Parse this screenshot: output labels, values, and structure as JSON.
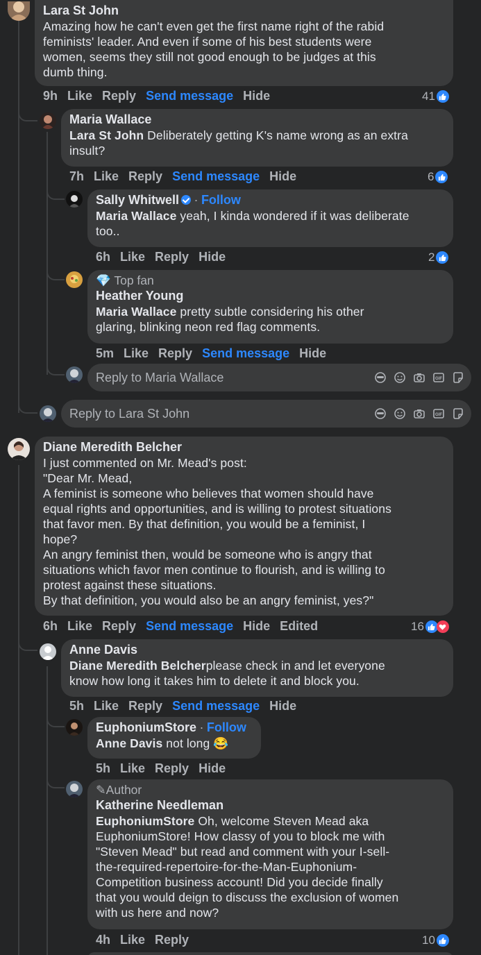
{
  "comments": [
    {
      "id": "lara",
      "author": "Lara St John",
      "lines": [
        "Amazing how he can't even get the first name right of the rabid",
        "feminists' leader. And even if some of his best students were",
        "women, seems they still not good enough to be judges at this",
        "dumb thing."
      ],
      "time": "9h",
      "actions": {
        "like": "Like",
        "reply": "Reply",
        "send": "Send message",
        "hide": "Hide"
      },
      "reactions": "41"
    },
    {
      "id": "maria",
      "author": "Maria Wallace",
      "mention": "Lara St John",
      "line1_rest": " Deliberately getting K's name wrong as an extra",
      "line2": "insult?",
      "time": "7h",
      "actions": {
        "like": "Like",
        "reply": "Reply",
        "send": "Send message",
        "hide": "Hide"
      },
      "reactions": "6"
    },
    {
      "id": "sally",
      "author": "Sally Whitwell",
      "separator": "·",
      "follow": "Follow",
      "mention": "Maria Wallace",
      "line1_rest": " yeah, I kinda wondered if it was deliberate",
      "line2": "too..",
      "time": "6h",
      "actions": {
        "like": "Like",
        "reply": "Reply",
        "hide": "Hide"
      },
      "reactions": "2"
    },
    {
      "id": "heather",
      "badge": "Top fan",
      "author": "Heather Young",
      "mention": "Maria Wallace",
      "line1_rest": " pretty subtle considering his other",
      "line2": "glaring, blinking neon red flag comments.",
      "time": "5m",
      "actions": {
        "like": "Like",
        "reply": "Reply",
        "send": "Send message",
        "hide": "Hide"
      }
    },
    {
      "id": "diane",
      "author": "Diane Meredith Belcher",
      "lines": [
        "I just commented on Mr. Mead's post:",
        "\"Dear Mr. Mead,",
        "A feminist is someone who believes that women should have",
        "equal rights and opportunities, and is willing to protest situations",
        "that favor men. By that definition, you would be a feminist, I",
        "hope?",
        "An angry feminist then, would be someone who is angry that",
        "situations which favor men continue to flourish, and is willing to",
        "protest against these situations.",
        "By that definition, you would also be an angry feminist, yes?\""
      ],
      "time": "6h",
      "actions": {
        "like": "Like",
        "reply": "Reply",
        "send": "Send message",
        "hide": "Hide",
        "edited": "Edited"
      },
      "reactions": "16"
    },
    {
      "id": "anne",
      "author": "Anne Davis",
      "mention": "Diane Meredith Belcher",
      "line1_rest": "please check in and let everyone",
      "line2": "know how long it takes him to delete it and block you.",
      "time": "5h",
      "actions": {
        "like": "Like",
        "reply": "Reply",
        "send": "Send message",
        "hide": "Hide"
      }
    },
    {
      "id": "euph",
      "author": "EuphoniumStore",
      "separator": "·",
      "follow": "Follow",
      "mention": "Anne Davis",
      "line1_rest": " not long 😂",
      "time": "5h",
      "actions": {
        "like": "Like",
        "reply": "Reply",
        "hide": "Hide"
      }
    },
    {
      "id": "katherine",
      "badge": "Author",
      "author": "Katherine Needleman",
      "mention": "EuphoniumStore",
      "line1_rest": " Oh, welcome Steven Mead aka",
      "lines": [
        "EuphoniumStore! How classy of you to block me with",
        "\"Steven Mead\" but read and comment with your I-sell-",
        "the-required-repertoire-for-the-Man-Euphonium-",
        "Competition business account! Did you decide finally",
        "that you would deign to discuss the exclusion of women",
        "with us here and now?"
      ],
      "time": "4h",
      "actions": {
        "like": "Like",
        "reply": "Reply"
      },
      "reactions": "10"
    }
  ],
  "reply_boxes": {
    "maria": "Reply to Maria Wallace",
    "lara": "Reply to Lara St John"
  },
  "colors": {
    "background": "#242526",
    "bubble": "#3a3b3c",
    "link": "#2d88ff",
    "like": "#2d88ff",
    "love": "#f33e58"
  }
}
